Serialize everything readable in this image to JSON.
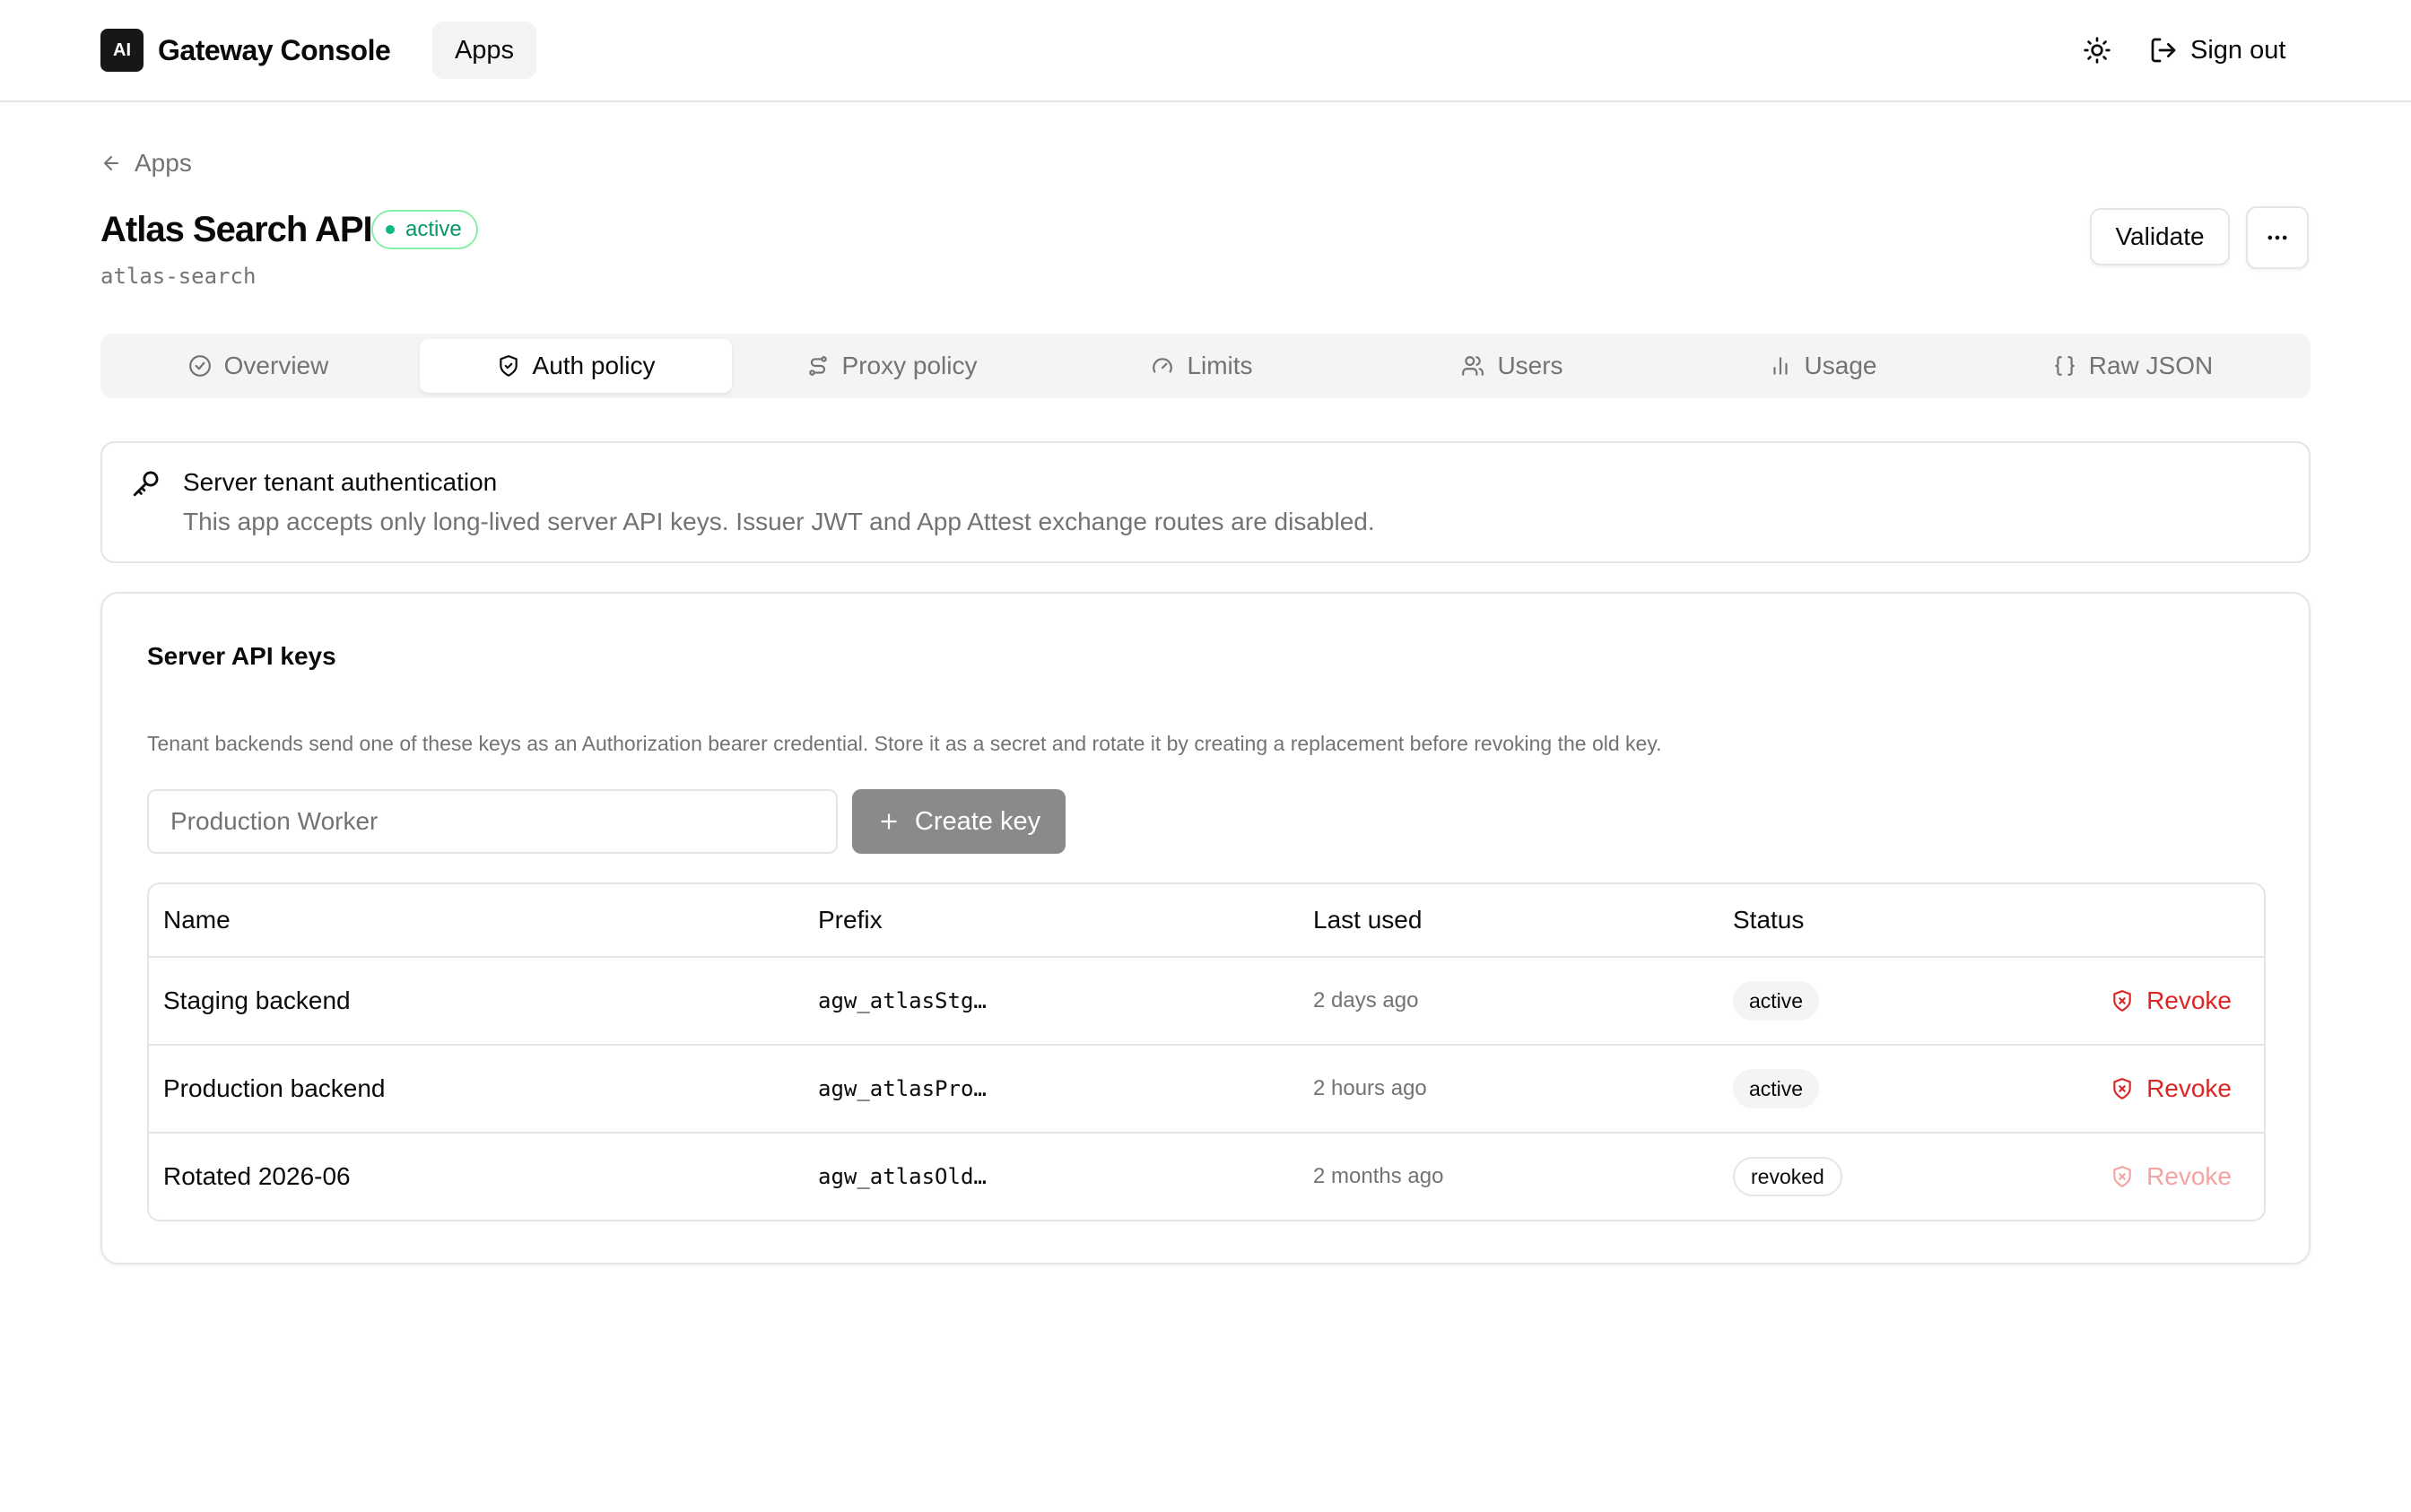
{
  "header": {
    "logo_text": "AI",
    "brand": "Gateway Console",
    "nav_apps": "Apps",
    "theme_icon": "sun-icon",
    "signout_label": "Sign out"
  },
  "breadcrumb": {
    "label": "Apps"
  },
  "app": {
    "title": "Atlas Search API",
    "status": "active",
    "slug": "atlas-search",
    "validate_label": "Validate"
  },
  "tabs": [
    {
      "label": "Overview",
      "icon": "check-circle-icon"
    },
    {
      "label": "Auth policy",
      "icon": "shield-icon",
      "active": true
    },
    {
      "label": "Proxy policy",
      "icon": "route-icon"
    },
    {
      "label": "Limits",
      "icon": "gauge-icon"
    },
    {
      "label": "Users",
      "icon": "users-icon"
    },
    {
      "label": "Usage",
      "icon": "bar-chart-icon"
    },
    {
      "label": "Raw JSON",
      "icon": "braces-icon"
    }
  ],
  "info": {
    "title": "Server tenant authentication",
    "text": "This app accepts only long-lived server API keys. Issuer JWT and App Attest exchange routes are disabled."
  },
  "keys": {
    "title": "Server API keys",
    "description": "Tenant backends send one of these keys as an Authorization bearer credential. Store it as a secret and rotate it by creating a replacement before revoking the old key.",
    "input_placeholder": "Production Worker",
    "create_label": "Create key",
    "columns": [
      "Name",
      "Prefix",
      "Last used",
      "Status"
    ],
    "rows": [
      {
        "name": "Staging backend",
        "prefix": "agw_atlasStg…",
        "last_used": "2 days ago",
        "status": "active",
        "action": "Revoke"
      },
      {
        "name": "Production backend",
        "prefix": "agw_atlasPro…",
        "last_used": "2 hours ago",
        "status": "active",
        "action": "Revoke"
      },
      {
        "name": "Rotated 2026-06",
        "prefix": "agw_atlasOld…",
        "last_used": "2 months ago",
        "status": "revoked",
        "action": "Revoke"
      }
    ]
  },
  "colors": {
    "accent_green": "#10b981",
    "danger_red": "#dc2626",
    "muted_text": "#737373",
    "border": "#e5e5e5"
  }
}
